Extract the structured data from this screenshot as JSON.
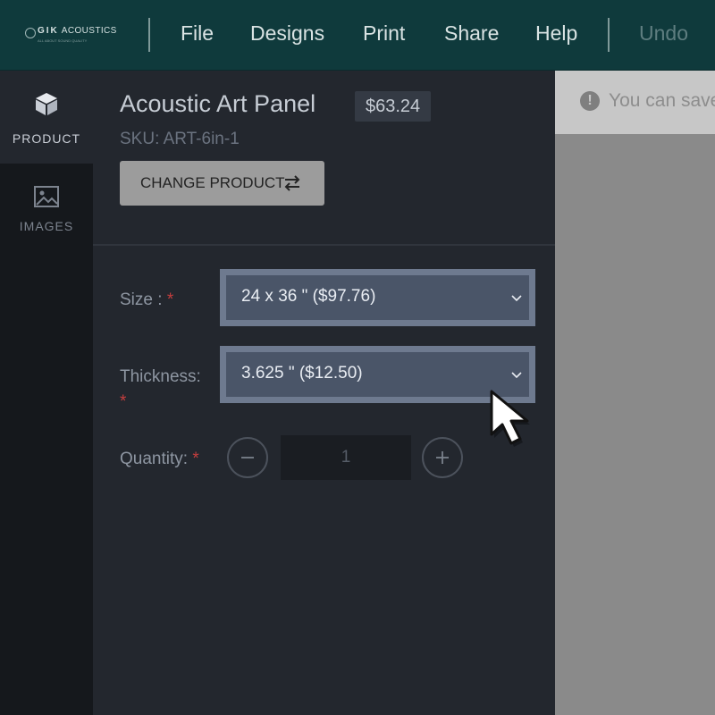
{
  "header": {
    "logo": {
      "brand_bold": "GIK",
      "brand": "ACOUSTICS",
      "tagline": "ALL ABOUT SOUND QUALITY"
    },
    "menu": [
      {
        "label": "File",
        "enabled": true
      },
      {
        "label": "Designs",
        "enabled": true
      },
      {
        "label": "Print",
        "enabled": true
      },
      {
        "label": "Share",
        "enabled": true
      },
      {
        "label": "Help",
        "enabled": true
      },
      {
        "label": "Undo",
        "enabled": false
      }
    ]
  },
  "rail": {
    "tabs": [
      {
        "label": "PRODUCT",
        "icon": "cube-icon",
        "active": true
      },
      {
        "label": "IMAGES",
        "icon": "image-icon",
        "active": false
      }
    ]
  },
  "product": {
    "title": "Acoustic Art Panel",
    "price": "$63.24",
    "sku": "SKU: ART-6in-1",
    "change_label": "CHANGE PRODUCT",
    "change_icon": "swap-arrows-icon"
  },
  "options": {
    "size": {
      "label": "Size :",
      "required_mark": "*",
      "value": "24 x 36 \" ($97.76)"
    },
    "thickness": {
      "label": "Thickness:",
      "required_mark": "*",
      "value": "3.625 \" ($12.50)"
    },
    "quantity": {
      "label": "Quantity:",
      "required_mark": "*",
      "value": "1"
    }
  },
  "notice": {
    "icon": "exclamation-icon",
    "text": "You can save"
  },
  "colors": {
    "header_bg": "#0f3a3c",
    "panel_bg": "#23272e",
    "required": "#c53e3e",
    "select_bg": "#4a5568"
  }
}
